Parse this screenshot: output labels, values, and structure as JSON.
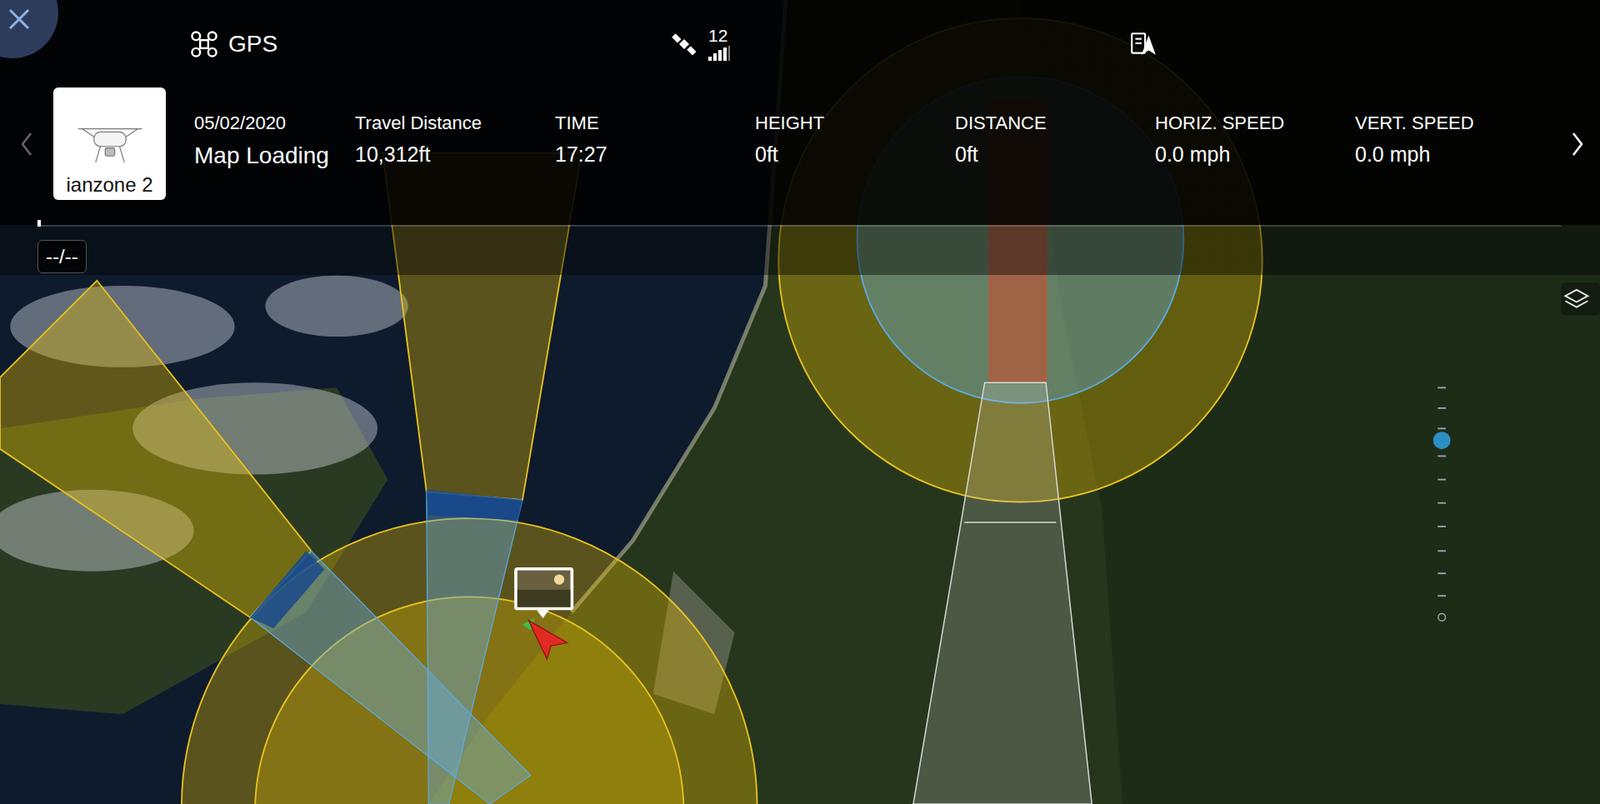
{
  "flight_record": {
    "connection": "GPS",
    "satellites": "12",
    "aircraft": {
      "name": "ianzone 2"
    },
    "date": "05/02/2020",
    "location": "Map Loading",
    "stats": [
      {
        "label": "Travel Distance",
        "value": "10,312ft"
      },
      {
        "label": "TIME",
        "value": "17:27"
      },
      {
        "label": "HEIGHT",
        "value": "0ft"
      },
      {
        "label": "DISTANCE",
        "value": "0ft"
      },
      {
        "label": "HORIZ. SPEED",
        "value": "0.0 mph"
      },
      {
        "label": "VERT. SPEED",
        "value": "0.0 mph"
      }
    ],
    "timeline": {
      "time": "--/--",
      "level": 0
    },
    "zoom": {
      "level": 0.77
    }
  }
}
